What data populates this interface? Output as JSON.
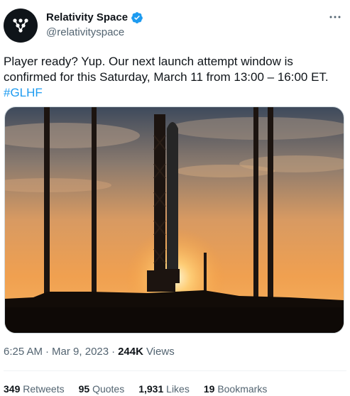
{
  "author": {
    "name": "Relativity Space",
    "handle": "@relativityspace"
  },
  "tweet": {
    "text": "Player ready? Yup. Our next launch attempt window is confirmed for this Saturday, March 11 from 13:00 – 16:00 ET.",
    "hashtag": "#GLHF"
  },
  "meta": {
    "time": "6:25 AM",
    "separator1": "·",
    "date": "Mar 9, 2023",
    "separator2": "·",
    "views_count": "244K",
    "views_label": "Views"
  },
  "stats": {
    "retweets": {
      "count": "349",
      "label": "Retweets"
    },
    "quotes": {
      "count": "95",
      "label": "Quotes"
    },
    "likes": {
      "count": "1,931",
      "label": "Likes"
    },
    "bookmarks": {
      "count": "19",
      "label": "Bookmarks"
    }
  },
  "icons": {
    "avatar": "relativity-logo-icon",
    "verified": "verified-badge-icon",
    "more": "more-options-icon"
  },
  "colors": {
    "accent": "#1d9bf0",
    "text": "#0f1419",
    "muted": "#536471"
  }
}
